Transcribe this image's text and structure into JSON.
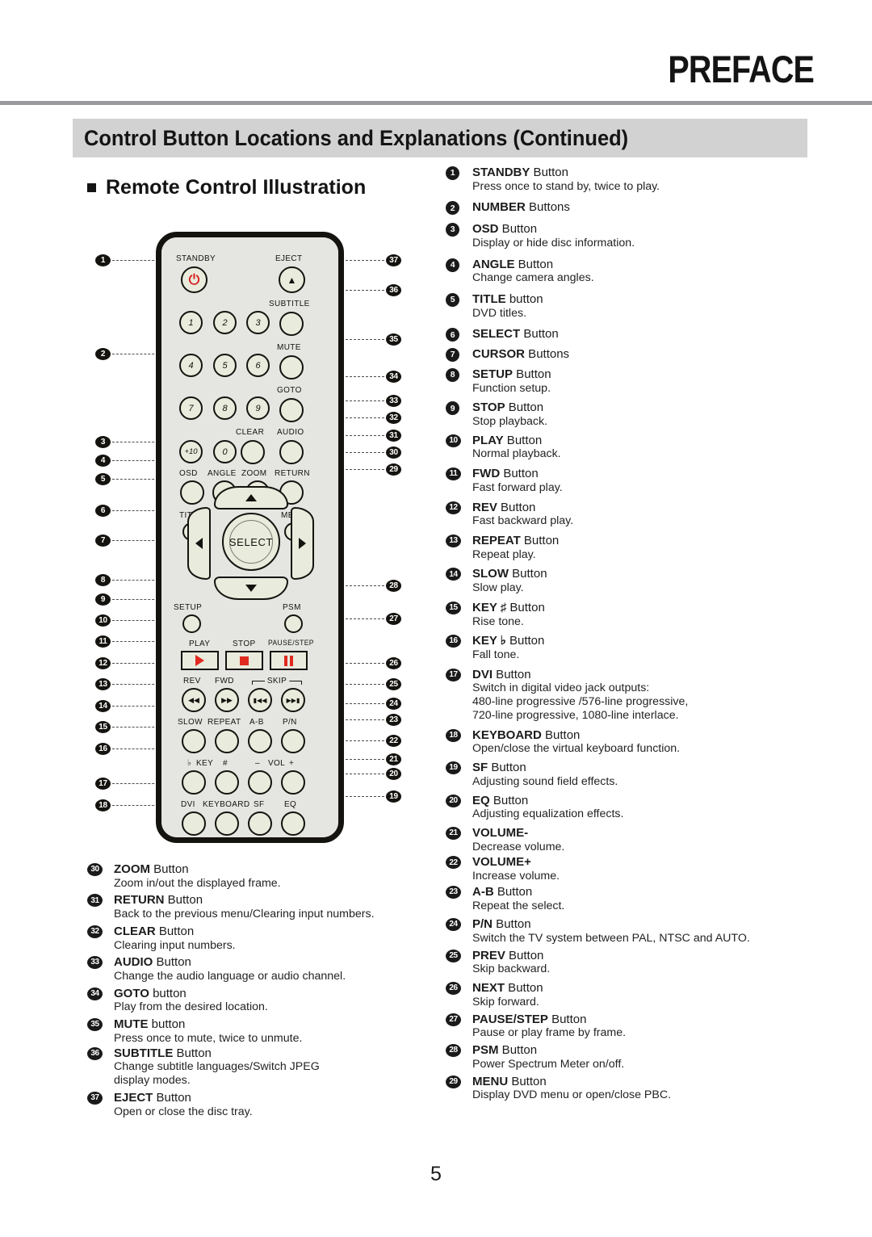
{
  "header": {
    "chapter": "PREFACE",
    "section_title": "Control Button Locations and Explanations (Continued)",
    "sub_heading": "Remote Control Illustration"
  },
  "page_number": "5",
  "remote": {
    "labels": {
      "standby": "STANDBY",
      "eject": "EJECT",
      "subtitle": "SUBTITLE",
      "mute": "MUTE",
      "goto": "GOTO",
      "clear": "CLEAR",
      "audio": "AUDIO",
      "osd": "OSD",
      "angle": "ANGLE",
      "zoom": "ZOOM",
      "return": "RETURN",
      "title": "TITLE",
      "menu": "MENU",
      "select": "SELECT",
      "setup": "SETUP",
      "psm": "PSM",
      "play": "PLAY",
      "stop": "STOP",
      "pause_step": "PAUSE/STEP",
      "rev": "REV",
      "fwd": "FWD",
      "skip": "SKIP",
      "slow": "SLOW",
      "repeat": "REPEAT",
      "ab": "A-B",
      "pn": "P/N",
      "key_flat": "♭",
      "key": "KEY",
      "key_sharp": "#",
      "vol_minus": "–",
      "vol": "VOL",
      "vol_plus": "+",
      "dvi": "DVI",
      "keyboard": "KEYBOARD",
      "sf": "SF",
      "eq": "EQ"
    },
    "number_keys": [
      "1",
      "2",
      "3",
      "4",
      "5",
      "6",
      "7",
      "8",
      "9",
      "+10",
      "0"
    ],
    "callouts_left": [
      "1",
      "2",
      "3",
      "4",
      "5",
      "6",
      "7",
      "8",
      "9",
      "10",
      "11",
      "12",
      "13",
      "14",
      "15",
      "16",
      "17",
      "18"
    ],
    "callouts_right": [
      "37",
      "36",
      "35",
      "34",
      "33",
      "32",
      "31",
      "30",
      "29",
      "28",
      "27",
      "26",
      "25",
      "24",
      "23",
      "22",
      "21",
      "20",
      "19"
    ]
  },
  "entries_right": [
    {
      "n": "1",
      "title": "STANDBY",
      "suffix": " Button",
      "desc": "Press once to stand by, twice to play."
    },
    {
      "n": "2",
      "title": "NUMBER",
      "suffix": " Buttons",
      "desc": ""
    },
    {
      "n": "3",
      "title": "OSD",
      "suffix": " Button",
      "desc": "Display or hide disc information."
    },
    {
      "n": "4",
      "title": "ANGLE",
      "suffix": " Button",
      "desc": "Change camera angles."
    },
    {
      "n": "5",
      "title": "TITLE",
      "suffix": " button",
      "desc": "DVD titles."
    },
    {
      "n": "6",
      "title": "SELECT",
      "suffix": " Button",
      "desc": ""
    },
    {
      "n": "7",
      "title": "CURSOR",
      "suffix": " Buttons",
      "desc": ""
    },
    {
      "n": "8",
      "title": "SETUP",
      "suffix": " Button",
      "desc": "Function setup."
    },
    {
      "n": "9",
      "title": "STOP",
      "suffix": " Button",
      "desc": "Stop playback."
    },
    {
      "n": "10",
      "title": "PLAY",
      "suffix": " Button",
      "desc": "Normal playback."
    },
    {
      "n": "11",
      "title": "FWD",
      "suffix": " Button",
      "desc": "Fast forward play."
    },
    {
      "n": "12",
      "title": "REV",
      "suffix": " Button",
      "desc": "Fast backward play."
    },
    {
      "n": "13",
      "title": "REPEAT",
      "suffix": " Button",
      "desc": "Repeat play."
    },
    {
      "n": "14",
      "title": "SLOW",
      "suffix": " Button",
      "desc": "Slow play."
    },
    {
      "n": "15",
      "title": "KEY ♯",
      "suffix": " Button",
      "desc": "Rise tone."
    },
    {
      "n": "16",
      "title": "KEY ♭",
      "suffix": " Button",
      "desc": "Fall tone."
    },
    {
      "n": "17",
      "title": "DVI",
      "suffix": " Button",
      "desc": "Switch in digital video jack outputs:\n480-line progressive /576-line progressive,\n720-line progressive, 1080-line interlace."
    },
    {
      "n": "18",
      "title": "KEYBOARD",
      "suffix": " Button",
      "desc": "Open/close the virtual keyboard function."
    },
    {
      "n": "19",
      "title": "SF",
      "suffix": " Button",
      "desc": "Adjusting sound field effects."
    },
    {
      "n": "20",
      "title": "EQ",
      "suffix": " Button",
      "desc": "Adjusting equalization effects."
    },
    {
      "n": "21",
      "title": "VOLUME-",
      "suffix": "",
      "desc": "Decrease volume."
    },
    {
      "n": "22",
      "title": "VOLUME+",
      "suffix": "",
      "desc": "Increase volume."
    },
    {
      "n": "23",
      "title": "A-B",
      "suffix": " Button",
      "desc": "Repeat the select."
    },
    {
      "n": "24",
      "title": "P/N",
      "suffix": " Button",
      "desc": "Switch the TV system between PAL, NTSC and AUTO."
    },
    {
      "n": "25",
      "title": "PREV",
      "suffix": " Button",
      "desc": "Skip backward."
    },
    {
      "n": "26",
      "title": "NEXT",
      "suffix": " Button",
      "desc": "Skip forward."
    },
    {
      "n": "27",
      "title": "PAUSE/STEP",
      "suffix": " Button",
      "desc": "Pause or play frame by frame."
    },
    {
      "n": "28",
      "title": "PSM",
      "suffix": " Button",
      "desc": "Power Spectrum Meter on/off."
    },
    {
      "n": "29",
      "title": "MENU",
      "suffix": " Button",
      "desc": "Display DVD menu or open/close PBC."
    }
  ],
  "entries_left_bottom": [
    {
      "n": "30",
      "title": "ZOOM",
      "suffix": " Button",
      "desc": "Zoom in/out the displayed frame."
    },
    {
      "n": "31",
      "title": "RETURN",
      "suffix": " Button",
      "desc": "Back to the previous menu/Clearing input numbers."
    },
    {
      "n": "32",
      "title": "CLEAR",
      "suffix": "  Button",
      "desc": "Clearing input numbers."
    },
    {
      "n": "33",
      "title": "AUDIO",
      "suffix": " Button",
      "desc": "Change the audio language or audio channel."
    },
    {
      "n": "34",
      "title": "GOTO",
      "suffix": " button",
      "desc": "Play from the desired location."
    },
    {
      "n": "35",
      "title": "MUTE",
      "suffix": " button",
      "desc": "Press once to mute, twice to unmute."
    },
    {
      "n": "36",
      "title": "SUBTITLE",
      "suffix": " Button",
      "desc": "Change subtitle languages/Switch JPEG\ndisplay modes."
    },
    {
      "n": "37",
      "title": "EJECT",
      "suffix": " Button",
      "desc": "Open or close the disc tray."
    }
  ],
  "colors": {
    "rule": "#9a9a9e",
    "section_bar": "#d2d2d2",
    "remote_body": "#e3e3e0",
    "remote_outline": "#15130f",
    "button_face": "#e9ebdc",
    "accent_red": "#d8221f"
  }
}
